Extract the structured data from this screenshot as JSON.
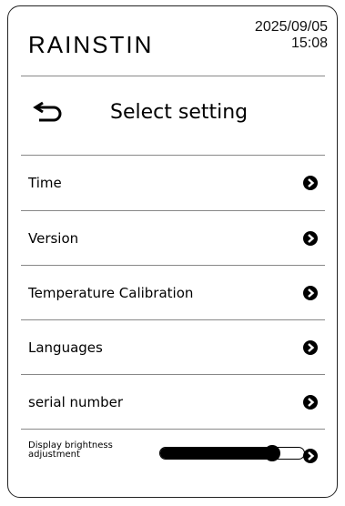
{
  "header": {
    "brand": "RAINSTIN",
    "date": "2025/09/05",
    "time": "15:08"
  },
  "screen": {
    "title": "Select setting",
    "back_icon": "back-arrow-icon"
  },
  "menu": {
    "items": [
      {
        "label": "Time",
        "icon": "chevron-right-circle-icon"
      },
      {
        "label": "Version",
        "icon": "chevron-right-circle-icon"
      },
      {
        "label": "Temperature Calibration",
        "icon": "chevron-right-circle-icon"
      },
      {
        "label": "Languages",
        "icon": "chevron-right-circle-icon"
      },
      {
        "label": "serial number",
        "icon": "chevron-right-circle-icon"
      }
    ],
    "brightness": {
      "label_line1": "Display brightness",
      "label_line2": "adjustment",
      "level": 0.78,
      "icon": "chevron-right-circle-icon"
    }
  },
  "colors": {
    "border": "#222222",
    "separator": "#888888",
    "text": "#000000",
    "background": "#ffffff"
  }
}
